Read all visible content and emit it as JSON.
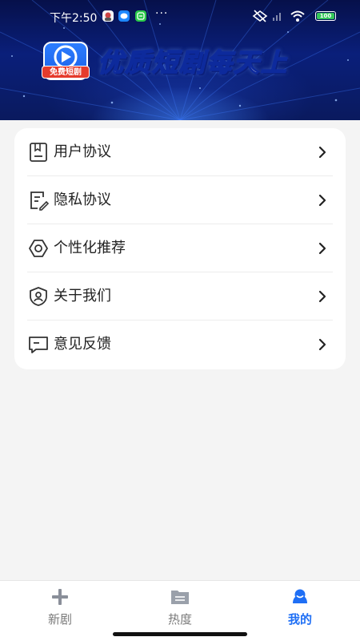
{
  "status_bar": {
    "time": "下午2:50",
    "dots": "···",
    "battery": "100"
  },
  "banner": {
    "logo_badge": "免费短剧",
    "slogan": "优质短剧每天上"
  },
  "menu": {
    "items": [
      {
        "label": "用户协议",
        "icon": "document-icon"
      },
      {
        "label": "隐私协议",
        "icon": "edit-document-icon"
      },
      {
        "label": "个性化推荐",
        "icon": "gear-icon"
      },
      {
        "label": "关于我们",
        "icon": "shield-user-icon"
      },
      {
        "label": "意见反馈",
        "icon": "chat-bubble-icon"
      }
    ]
  },
  "tabbar": {
    "tabs": [
      {
        "label": "新剧",
        "icon": "plus-icon",
        "active": false
      },
      {
        "label": "热度",
        "icon": "folder-icon",
        "active": false
      },
      {
        "label": "我的",
        "icon": "user-icon",
        "active": true
      }
    ]
  },
  "colors": {
    "accent": "#1f6ff5",
    "banner_dark": "#06104a",
    "background": "#f4f4f4"
  }
}
